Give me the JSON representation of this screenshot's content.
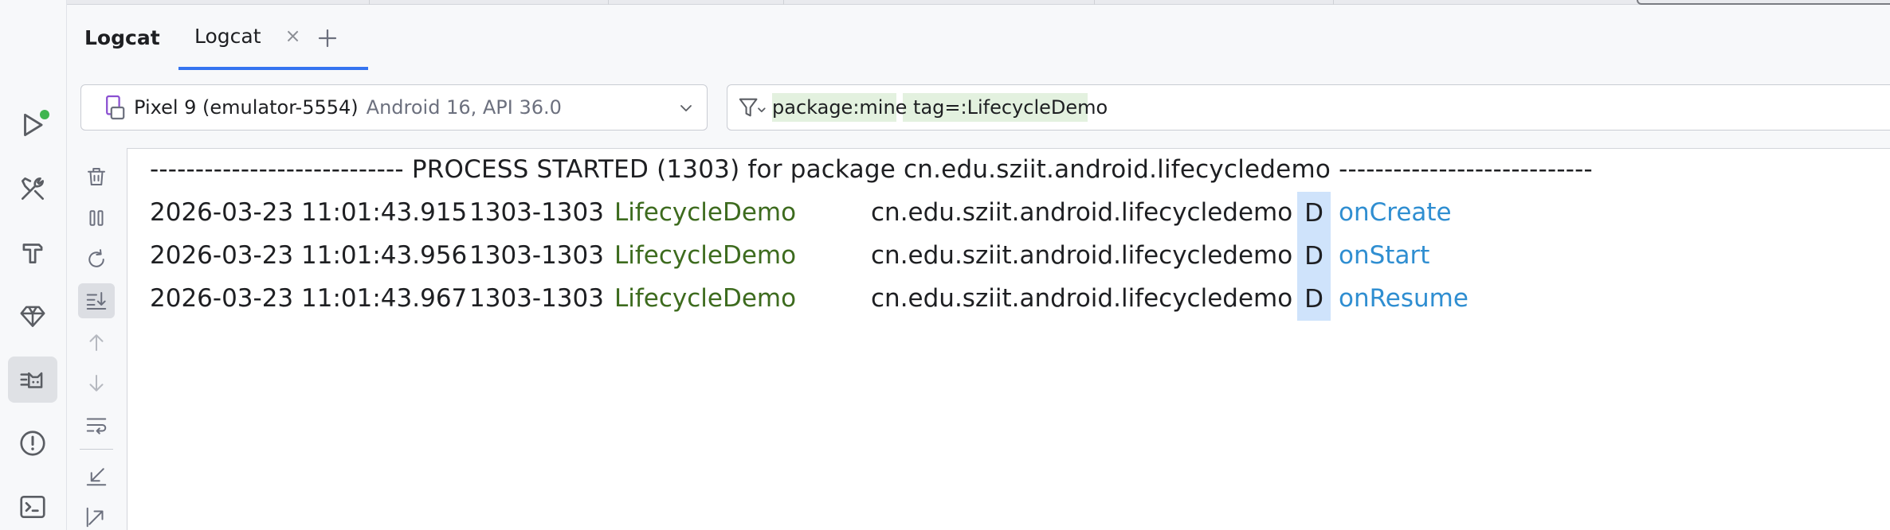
{
  "tool_window": {
    "title": "Logcat",
    "tab_label": "Logcat",
    "tab_close": "×"
  },
  "device": {
    "name": "Pixel 9 (emulator-5554)",
    "os": "Android 16, API 36.0"
  },
  "filter": {
    "query": "package:mine tag=:LifecycleDemo"
  },
  "log": {
    "header": "---------------------------- PROCESS STARTED (1303) for package cn.edu.sziit.android.lifecycledemo ----------------------------",
    "rows": [
      {
        "timestamp": "2026-03-23 11:01:43.915",
        "pid_tid": "1303-1303",
        "tag": "LifecycleDemo",
        "package": "cn.edu.sziit.android.lifecycledemo",
        "level": "D",
        "message": "onCreate"
      },
      {
        "timestamp": "2026-03-23 11:01:43.956",
        "pid_tid": "1303-1303",
        "tag": "LifecycleDemo",
        "package": "cn.edu.sziit.android.lifecycledemo",
        "level": "D",
        "message": "onStart"
      },
      {
        "timestamp": "2026-03-23 11:01:43.967",
        "pid_tid": "1303-1303",
        "tag": "LifecycleDemo",
        "package": "cn.edu.sziit.android.lifecycledemo",
        "level": "D",
        "message": "onResume"
      }
    ]
  },
  "colors": {
    "tag": "#3d6b1e",
    "message_debug": "#2f8ed1",
    "level_highlight": "#cfe3fb",
    "filter_highlight": "#e3f1df",
    "run_indicator": "#3fb54f"
  },
  "icons": {
    "left_bar": [
      "run-icon",
      "build-tools-icon",
      "hammer-icon",
      "gem-icon",
      "logcat-icon",
      "problems-icon",
      "terminal-icon"
    ],
    "toolbar": [
      "trash-icon",
      "pause-icon",
      "restart-icon",
      "scroll-to-end-icon",
      "arrow-up-icon",
      "arrow-down-icon",
      "soft-wrap-icon",
      "collapse-icon",
      "expand-icon"
    ]
  }
}
